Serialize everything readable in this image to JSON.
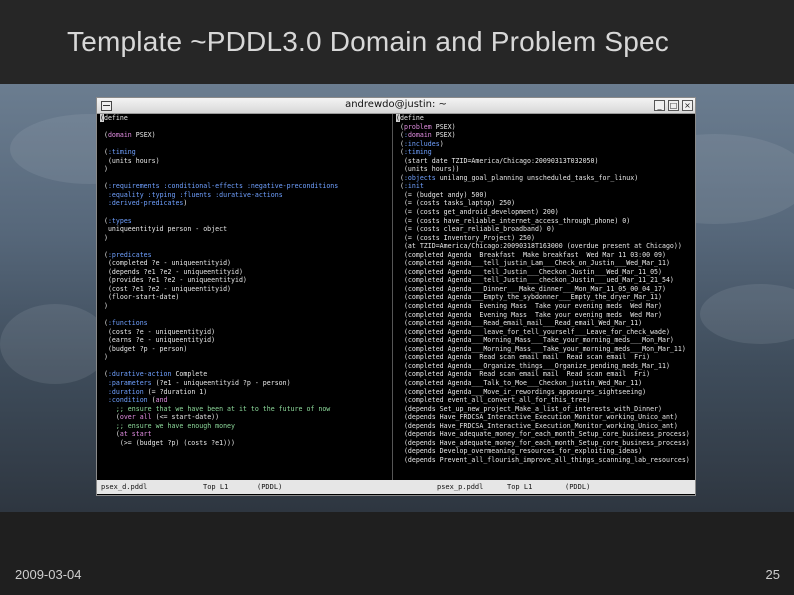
{
  "slide": {
    "title": "Template ~PDDL3.0 Domain and Problem Spec",
    "footer_date": "2009-03-04",
    "page_number": "25"
  },
  "window": {
    "title": "andrewdo@justin: ~",
    "buttons": [
      "_",
      "□",
      "×"
    ]
  },
  "left_pane_lines": [
    "(define",
    "",
    " (domain PSEX)",
    "",
    " (:timing",
    "  (units hours)",
    " )",
    "",
    " (:requirements :conditional-effects :negative-preconditions",
    "  :equality :typing :fluents :durative-actions",
    "  :derived-predicates)",
    "",
    " (:types",
    "  uniqueentityid person - object",
    " )",
    "",
    " (:predicates",
    "  (completed ?e - uniqueentityid)",
    "  (depends ?e1 ?e2 - uniqueentityid)",
    "  (provides ?e1 ?e2 - uniqueentityid)",
    "  (cost ?e1 ?e2 - uniqueentityid)",
    "  (floor-start-date)",
    " )",
    "",
    " (:functions",
    "  (costs ?e - uniqueentityid)",
    "  (earns ?e - uniqueentityid)",
    "  (budget ?p - person)",
    " )",
    "",
    " (:durative-action Complete",
    "  :parameters (?e1 - uniqueentityid ?p - person)",
    "  :duration (= ?duration 1)",
    "  :condition (and",
    "    ;; ensure that we have been at it to the future of now",
    "    (over all (<= start-date))",
    "    ;; ensure we have enough money",
    "    (at start",
    "     (>= (budget ?p) (costs ?e1)))"
  ],
  "right_pane_lines": [
    "(define",
    " (problem PSEX)",
    " (:domain PSEX)",
    " (:includes)",
    " (:timing",
    "  (start date TZID=America/Chicago:20090313T032050)",
    "  (units hours))",
    " (:objects unilang_goal_planning unscheduled_tasks_for_linux)",
    " (:init",
    "  (= (budget andy) 500)",
    "  (= (costs tasks_laptop) 250)",
    "  (= (costs get_android_development) 200)",
    "  (= (costs have_reliable_internet_access_through_phone) 0)",
    "  (= (costs clear_reliable_broadband) 0)",
    "  (= (costs Inventory_Project) 250)",
    "  (at TZID=America/Chicago:20090318T163000 (overdue present at Chicago))",
    "  (completed Agenda  Breakfast  Make breakfast  Wed Mar 11 03:00 09)",
    "  (completed Agenda___tell_justin_Lam___Check_on_Justin___Wed_Mar_11)",
    "  (completed Agenda___tell_Justin___Checkon_Justin___Wed_Mar_11_05)",
    "  (completed Agenda___tell_Justin___checkon_Justin___ued_Mar_11_21_54)",
    "  (completed Agenda___Dinner___Make_dinner___Mon_Mar_11_05_00_04_17)",
    "  (completed Agenda___Empty_the_sybdonner___Empty_the_dryer_Mar_11)",
    "  (completed Agenda  Evening Mass  Take your evening meds  Wed Mar)",
    "  (completed Agenda  Evening Mass  Take your evening meds  Wed Mar)",
    "  (completed Agenda___Read_email_mail___Read_email_Wed_Mar_11)",
    "  (completed Agenda___leave_for_tell_yourself___Leave_for_check_wade)",
    "  (completed Agenda___Morning_Mass___Take_your_morning_meds___Mon_Mar)",
    "  (completed Agenda___Morning_Mass___Take_your_morning_meds___Mon_Mar_11)",
    "  (completed Agenda  Read scan email mail  Read scan email  Fri)",
    "  (completed Agenda___Organize_things___Organize_pending_meds_Mar_11)",
    "  (completed Agenda  Read scan email mail  Read scan email  Fri)",
    "  (completed Agenda___Talk_to_Moe___Checkon_justin_Wed_Mar_11)",
    "  (completed Agenda___Move_ir_rewordings_apposures_sightseeing)",
    "  (completed event_all_convert_all_for_this_tree)",
    "  (depends Set_up_new_project_Make_a_list_of_interests_with_Dinner)",
    "  (depends Have_FRDCSA_Interactive_Execution_Monitor_working_Unico_ant)",
    "  (depends Have_FRDCSA_Interactive_Execution_Monitor_working_Unico_ant)",
    "  (depends Have_adequate_money_for_each_month_Setup_core_business_process)",
    "  (depends Have_adequate_money_for_each_month_Setup_core_business_process)",
    "  (depends Develop_overmeaning_resources_for_exploiting_ideas)",
    "  (depends Prevent_all_flourish_improve_all_things_scanning_lab_resources)"
  ],
  "status": {
    "left_file": "psex_d.pddl",
    "left_pos": "Top L1",
    "left_mode": "(PDDL)",
    "right_file": "psex_p.pddl",
    "right_pos": "Top L1",
    "right_mode": "(PDDL)"
  }
}
